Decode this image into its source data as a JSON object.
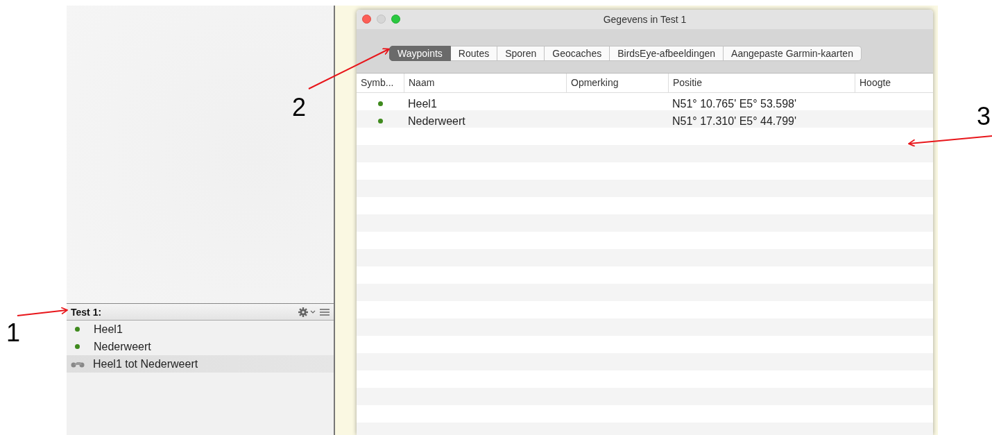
{
  "sidebar": {
    "title": "Test 1:",
    "items": [
      {
        "kind": "waypoint",
        "label": "Heel1",
        "selected": false
      },
      {
        "kind": "waypoint",
        "label": "Nederweert",
        "selected": false
      },
      {
        "kind": "route",
        "label": "Heel1 tot Nederweert",
        "selected": true
      }
    ]
  },
  "window": {
    "title": "Gegevens in Test 1"
  },
  "tabs": [
    {
      "label": "Waypoints",
      "selected": true
    },
    {
      "label": "Routes",
      "selected": false
    },
    {
      "label": "Sporen",
      "selected": false
    },
    {
      "label": "Geocaches",
      "selected": false
    },
    {
      "label": "BirdsEye-afbeeldingen",
      "selected": false
    },
    {
      "label": "Aangepaste Garmin-kaarten",
      "selected": false
    }
  ],
  "table": {
    "columns": [
      "Symb...",
      "Naam",
      "Opmerking",
      "Positie",
      "Hoogte"
    ],
    "rows": [
      {
        "name": "Heel1",
        "position": "N51° 10.765' E5° 53.598'"
      },
      {
        "name": "Nederweert",
        "position": "N51° 17.310' E5° 44.799'"
      }
    ]
  },
  "annotations": [
    {
      "label": "1"
    },
    {
      "label": "2"
    },
    {
      "label": "3"
    }
  ]
}
